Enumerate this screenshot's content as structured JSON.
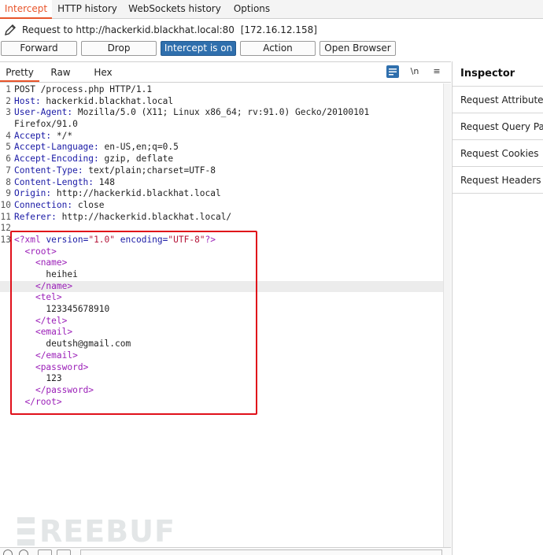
{
  "tabs": [
    "Intercept",
    "HTTP history",
    "WebSockets history",
    "Options"
  ],
  "request_bar": {
    "label": "Request to http://hackerkid.blackhat.local:80",
    "ip": "[172.16.12.158]"
  },
  "buttons": {
    "forward": "Forward",
    "drop": "Drop",
    "intercept": "Intercept is on",
    "action": "Action",
    "open_browser": "Open Browser"
  },
  "editor_tabs": [
    "Pretty",
    "Raw",
    "Hex"
  ],
  "editor_icons": {
    "newline": "\\n",
    "menu": "≡"
  },
  "code_lines": [
    {
      "n": "1",
      "h": "POST /process.php HTTP/1.1"
    },
    {
      "n": "2",
      "h": "<span class='k'>Host:</span> hackerkid.blackhat.local"
    },
    {
      "n": "3",
      "h": "<span class='k'>User-Agent:</span> Mozilla/5.0 (X11; Linux x86_64; rv:91.0) Gecko/20100101"
    },
    {
      "n": "",
      "h": "Firefox/91.0"
    },
    {
      "n": "4",
      "h": "<span class='k'>Accept:</span> */*"
    },
    {
      "n": "5",
      "h": "<span class='k'>Accept-Language:</span> en-US,en;q=0.5"
    },
    {
      "n": "6",
      "h": "<span class='k'>Accept-Encoding:</span> gzip, deflate"
    },
    {
      "n": "7",
      "h": "<span class='k'>Content-Type:</span> text/plain;charset=UTF-8"
    },
    {
      "n": "8",
      "h": "<span class='k'>Content-Length:</span> 148"
    },
    {
      "n": "9",
      "h": "<span class='k'>Origin:</span> http://hackerkid.blackhat.local"
    },
    {
      "n": "10",
      "h": "<span class='k'>Connection:</span> close"
    },
    {
      "n": "11",
      "h": "<span class='k'>Referer:</span> http://hackerkid.blackhat.local/"
    },
    {
      "n": "12",
      "h": ""
    },
    {
      "n": "13",
      "h": "<span class='tag'>&lt;?xml</span> <span class='attr'>version=</span><span class='str'>\"1.0\"</span> <span class='attr'>encoding=</span><span class='str'>\"UTF-8\"</span><span class='tag'>?&gt;</span>"
    },
    {
      "n": "",
      "h": "  <span class='tag'>&lt;root&gt;</span>"
    },
    {
      "n": "",
      "h": "    <span class='tag'>&lt;name&gt;</span>"
    },
    {
      "n": "",
      "h": "      heihei"
    },
    {
      "n": "",
      "h": "    <span class='tag'>&lt;/name&gt;</span>",
      "hl": true
    },
    {
      "n": "",
      "h": "    <span class='tag'>&lt;tel&gt;</span>"
    },
    {
      "n": "",
      "h": "      123345678910"
    },
    {
      "n": "",
      "h": "    <span class='tag'>&lt;/tel&gt;</span>"
    },
    {
      "n": "",
      "h": "    <span class='tag'>&lt;email&gt;</span>"
    },
    {
      "n": "",
      "h": "      deutsh@gmail.com"
    },
    {
      "n": "",
      "h": "    <span class='tag'>&lt;/email&gt;</span>"
    },
    {
      "n": "",
      "h": "    <span class='tag'>&lt;password&gt;</span>"
    },
    {
      "n": "",
      "h": "      123"
    },
    {
      "n": "",
      "h": "    <span class='tag'>&lt;/password&gt;</span>"
    },
    {
      "n": "",
      "h": "  <span class='tag'>&lt;/root&gt;</span>"
    }
  ],
  "inspector": {
    "title": "Inspector",
    "items": [
      "Request Attributes",
      "Request Query Parameters",
      "Request Cookies",
      "Request Headers"
    ]
  },
  "watermark": "REEBUF",
  "colors": {
    "accent": "#e8542a",
    "intercept_on": "#2f6fad",
    "highlight_box": "#e0101a"
  }
}
